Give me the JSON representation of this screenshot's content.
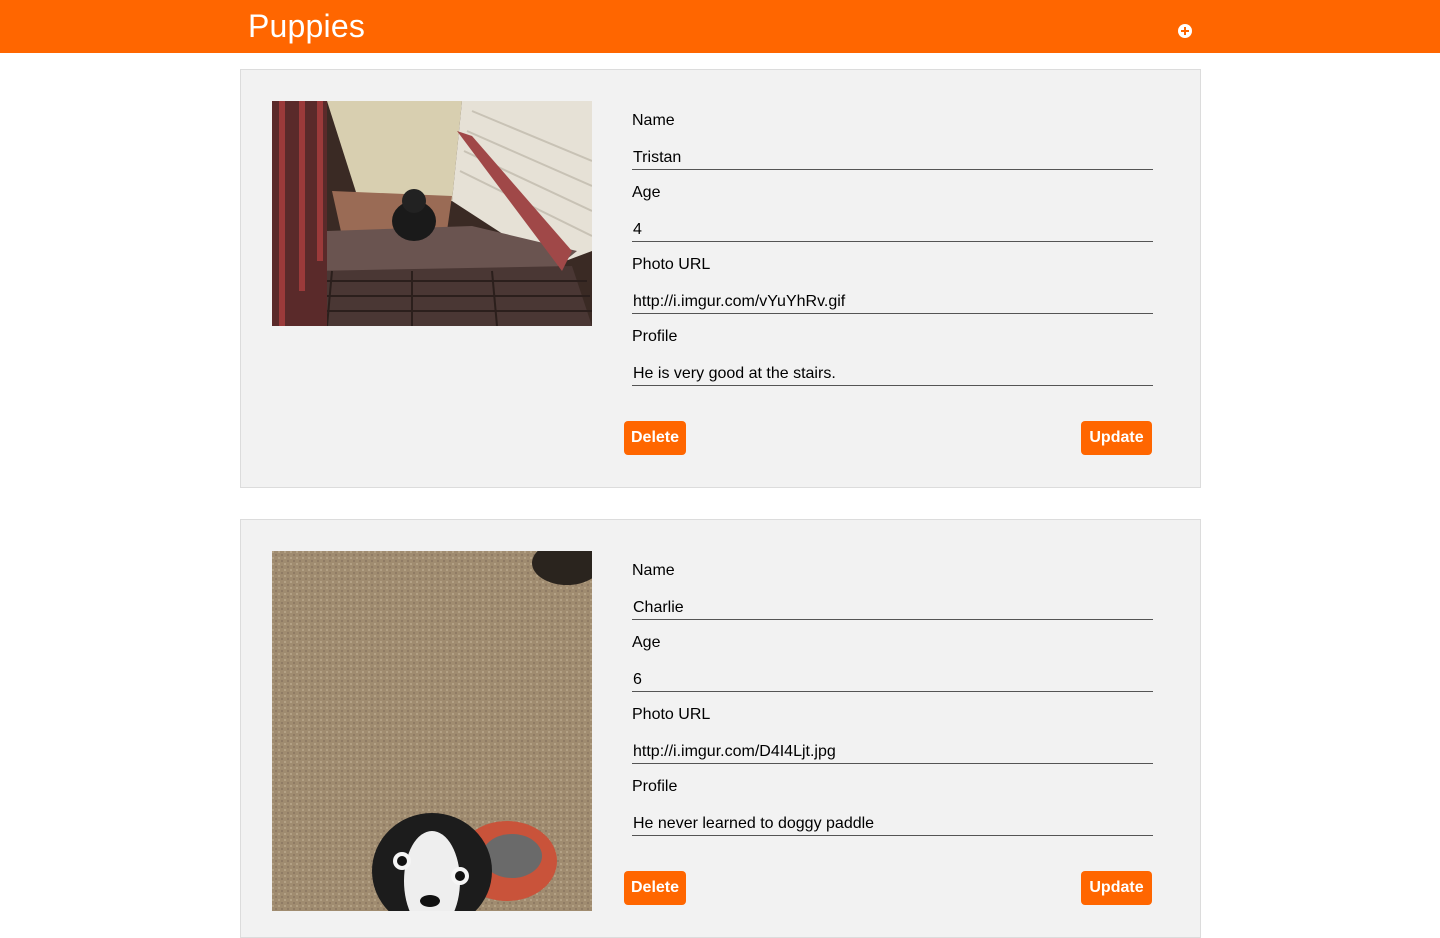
{
  "header": {
    "title": "Puppies",
    "add_icon": "plus-circle-icon"
  },
  "colors": {
    "accent": "#ff6600",
    "card_bg": "#f2f2f2"
  },
  "puppies": [
    {
      "name_label": "Name",
      "name": "Tristan",
      "age_label": "Age",
      "age": "4",
      "photo_label": "Photo URL",
      "photo_url": "http://i.imgur.com/vYuYhRv.gif",
      "profile_label": "Profile",
      "profile": "He is very good at the stairs.",
      "delete_label": "Delete",
      "update_label": "Update"
    },
    {
      "name_label": "Name",
      "name": "Charlie",
      "age_label": "Age",
      "age": "6",
      "photo_label": "Photo URL",
      "photo_url": "http://i.imgur.com/D4I4Ljt.jpg",
      "profile_label": "Profile",
      "profile": "He never learned to doggy paddle",
      "delete_label": "Delete",
      "update_label": "Update"
    }
  ]
}
